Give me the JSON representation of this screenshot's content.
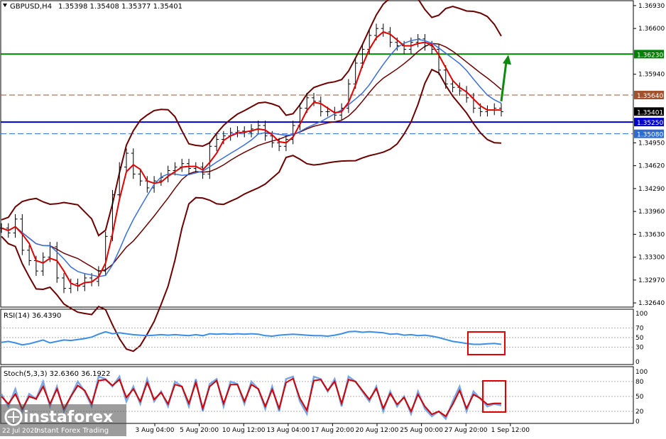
{
  "main_header": {
    "symbol_tf": "GBPUSD,H4",
    "ohlc": "1.35398 1.35408 1.35377 1.35401"
  },
  "rsi_header": "RSI(14) 36.4390",
  "stoch_header": "Stoch(5,3,3) 32.6360 36.1922",
  "watermark": {
    "brand": "instaforex",
    "tagline": "Instant Forex Trading",
    "corner_date": "22 Jul 2020"
  },
  "colors": {
    "price_bars": "#000000",
    "bollinger": "#6b0000",
    "ma_fast": "#e00000",
    "ma_slow": "#3a6fd8",
    "green_line": "#008000",
    "blue_line": "#0000cc",
    "brown_dash": "#a0522d",
    "blue_dash": "#2b6cd4",
    "rsi_line": "#3a8ee6",
    "stoch_main": "#7aa6e6",
    "stoch_signal": "#cc0000",
    "box": "#e00000",
    "arrow": "#0b8a0b"
  },
  "chart_data": [
    {
      "type": "line",
      "y_axis_ticks": [
        "1.36930",
        "1.36600",
        "1.36230",
        "1.35940",
        "1.35640",
        "1.35401",
        "1.35250",
        "1.35080",
        "1.34950",
        "1.34620",
        "1.34290",
        "1.33960",
        "1.33630",
        "1.33300",
        "1.32970",
        "1.32640"
      ],
      "ylim": [
        1.3259,
        1.3697
      ],
      "x_tick_labels": [
        "3 Aug 04:00",
        "5 Aug 20:00",
        "10 Aug 12:00",
        "13 Aug 04:00",
        "17 Aug 20:00",
        "20 Aug 12:00",
        "25 Aug 00:00",
        "27 Aug 20:00",
        "1 Sep 12:00"
      ],
      "levels": [
        {
          "label": "1.36230",
          "value": 1.3623,
          "style": "solid",
          "color": "#008000"
        },
        {
          "label": "1.35640",
          "value": 1.3564,
          "style": "dashed",
          "color": "#a0522d"
        },
        {
          "label": "1.35401",
          "value": 1.35401,
          "style": "current",
          "color": "#000000"
        },
        {
          "label": "1.35250",
          "value": 1.3525,
          "style": "solid",
          "color": "#0000cc"
        },
        {
          "label": "1.35080",
          "value": 1.3508,
          "style": "dashed",
          "color": "#2b6cd4"
        }
      ],
      "close_series": [
        1.3372,
        1.3365,
        1.3385,
        1.334,
        1.3325,
        1.331,
        1.333,
        1.3345,
        1.33,
        1.3285,
        1.3292,
        1.3288,
        1.33,
        1.3295,
        1.331,
        1.336,
        1.342,
        1.346,
        1.348,
        1.345,
        1.344,
        1.343,
        1.344,
        1.3445,
        1.3455,
        1.346,
        1.3465,
        1.3458,
        1.346,
        1.345,
        1.349,
        1.35,
        1.3505,
        1.351,
        1.3512,
        1.351,
        1.3515,
        1.352,
        1.3505,
        1.3495,
        1.349,
        1.35,
        1.352,
        1.3545,
        1.356,
        1.3555,
        1.354,
        1.354,
        1.3535,
        1.3545,
        1.358,
        1.361,
        1.363,
        1.365,
        1.366,
        1.3655,
        1.364,
        1.3635,
        1.363,
        1.364,
        1.3645,
        1.3635,
        1.363,
        1.36,
        1.358,
        1.3575,
        1.357,
        1.356,
        1.3545,
        1.354,
        1.3542,
        1.3545,
        1.354
      ],
      "series_names": []
    },
    {
      "type": "line",
      "title": "RSI(14) 36.4390",
      "ylim": [
        0,
        100
      ],
      "y_axis_ticks": [
        "100",
        "70",
        "50",
        "30",
        "0"
      ],
      "levels": [
        70,
        50,
        30
      ],
      "values": [
        40,
        42,
        39,
        35,
        37,
        41,
        45,
        39,
        42,
        45,
        44,
        46,
        48,
        51,
        57,
        62,
        58,
        60,
        58,
        56,
        55,
        54,
        55,
        56,
        55,
        56,
        55,
        54,
        56,
        54,
        58,
        57,
        58,
        57,
        58,
        57,
        58,
        57,
        54,
        53,
        55,
        56,
        57,
        56,
        55,
        54,
        54,
        53,
        55,
        58,
        62,
        63,
        61,
        62,
        61,
        60,
        57,
        58,
        55,
        56,
        54,
        55,
        53,
        50,
        46,
        42,
        40,
        38,
        36,
        36,
        37,
        38,
        36
      ]
    },
    {
      "type": "line",
      "title": "Stoch(5,3,3) 32.6360 36.1922",
      "ylim": [
        0,
        100
      ],
      "y_axis_ticks": [
        "100",
        "80",
        "50",
        "20",
        "0"
      ],
      "levels": [
        80,
        50,
        20
      ],
      "series": [
        {
          "name": "main",
          "values": [
            55,
            30,
            65,
            20,
            55,
            45,
            80,
            30,
            70,
            20,
            50,
            80,
            60,
            30,
            90,
            85,
            70,
            90,
            40,
            70,
            35,
            85,
            40,
            60,
            30,
            80,
            70,
            30,
            85,
            20,
            75,
            85,
            30,
            80,
            75,
            35,
            80,
            65,
            25,
            70,
            20,
            85,
            90,
            40,
            15,
            90,
            85,
            60,
            85,
            30,
            90,
            80,
            60,
            40,
            70,
            20,
            60,
            30,
            50,
            15,
            60,
            25,
            10,
            20,
            5,
            40,
            70,
            20,
            60,
            45,
            30,
            35,
            32
          ]
        },
        {
          "name": "signal",
          "values": [
            50,
            35,
            55,
            25,
            50,
            45,
            70,
            35,
            65,
            25,
            50,
            72,
            62,
            35,
            82,
            84,
            72,
            84,
            48,
            65,
            40,
            78,
            44,
            58,
            35,
            74,
            70,
            36,
            78,
            26,
            70,
            82,
            36,
            74,
            74,
            40,
            74,
            65,
            30,
            64,
            26,
            78,
            86,
            46,
            22,
            82,
            84,
            62,
            80,
            36,
            84,
            80,
            62,
            44,
            66,
            26,
            56,
            34,
            48,
            20,
            54,
            30,
            14,
            20,
            10,
            34,
            62,
            26,
            54,
            46,
            34,
            36,
            36
          ]
        }
      ]
    }
  ]
}
